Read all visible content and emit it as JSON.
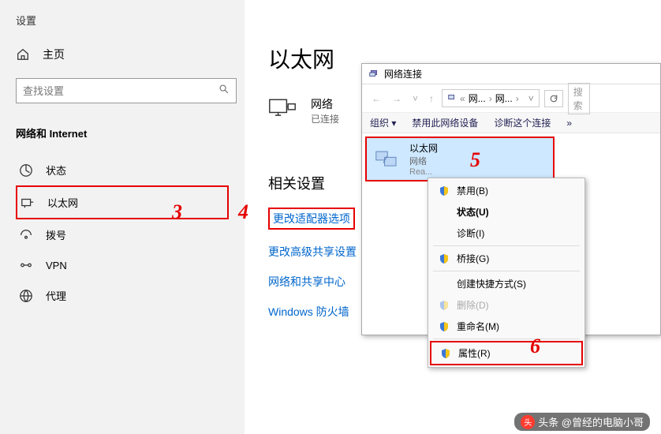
{
  "sidebar": {
    "title": "设置",
    "home": "主页",
    "search_placeholder": "查找设置",
    "category": "网络和 Internet",
    "items": [
      {
        "icon": "status",
        "label": "状态"
      },
      {
        "icon": "ethernet",
        "label": "以太网"
      },
      {
        "icon": "dialup",
        "label": "拨号"
      },
      {
        "icon": "vpn",
        "label": "VPN"
      },
      {
        "icon": "proxy",
        "label": "代理"
      }
    ]
  },
  "main": {
    "title": "以太网",
    "network": {
      "name": "网络",
      "status": "已连接"
    },
    "related_title": "相关设置",
    "links": [
      "更改适配器选项",
      "更改高级共享设置",
      "网络和共享中心",
      "Windows 防火墙"
    ]
  },
  "popup": {
    "title": "网络连接",
    "breadcrumb": {
      "sep": "«",
      "p1": "网...",
      "p2": "网...",
      "chev": "›"
    },
    "search_hint": "搜索",
    "toolbar": {
      "org": "组织 ▾",
      "disable": "禁用此网络设备",
      "diag": "诊断这个连接",
      "more": "»"
    },
    "item": {
      "name": "以太网",
      "net": "网络",
      "adapter": "Rea..."
    }
  },
  "context_menu": [
    {
      "label": "禁用(B)",
      "shield": true
    },
    {
      "label": "状态(U)",
      "bold": true
    },
    {
      "label": "诊断(I)"
    },
    {
      "sep": true
    },
    {
      "label": "桥接(G)",
      "shield": true
    },
    {
      "sep": true
    },
    {
      "label": "创建快捷方式(S)"
    },
    {
      "label": "删除(D)",
      "shield": true,
      "disabled": true
    },
    {
      "label": "重命名(M)",
      "shield": true
    },
    {
      "sep": true
    },
    {
      "label": "属性(R)",
      "shield": true,
      "boxed": true
    }
  ],
  "annotations": {
    "a3": "3",
    "a4": "4",
    "a5": "5",
    "a6": "6"
  },
  "watermark": "头条 @曾经的电脑小哥"
}
